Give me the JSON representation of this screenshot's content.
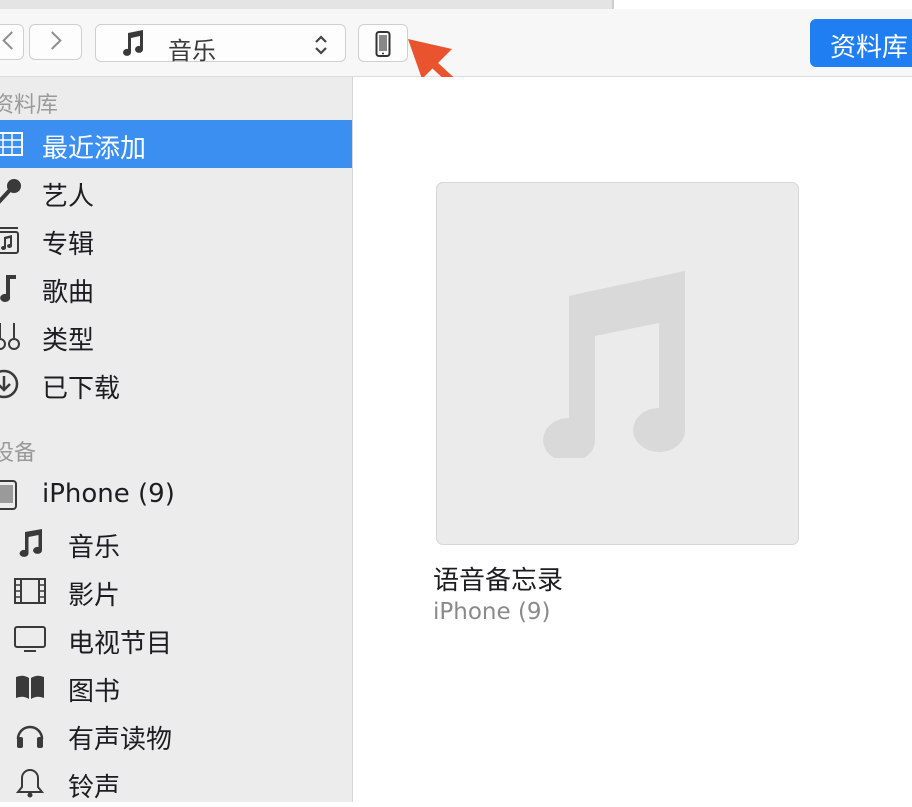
{
  "toolbar": {
    "media_kind": "音乐",
    "library_button": "资料库",
    "icons": {
      "back": "chevron-left-icon",
      "forward": "chevron-right-icon",
      "media": "music-note-icon",
      "device": "iphone-icon"
    }
  },
  "sidebar": {
    "library_header": "资料库",
    "library_items": [
      {
        "label": "最近添加",
        "icon": "recently-added-icon",
        "selected": true
      },
      {
        "label": "艺人",
        "icon": "microphone-icon",
        "selected": false
      },
      {
        "label": "专辑",
        "icon": "album-icon",
        "selected": false
      },
      {
        "label": "歌曲",
        "icon": "music-note-icon",
        "selected": false
      },
      {
        "label": "类型",
        "icon": "guitar-icon",
        "selected": false
      },
      {
        "label": "已下载",
        "icon": "download-icon",
        "selected": false
      }
    ],
    "devices_header": "设备",
    "device_name": "iPhone (9)",
    "device_items": [
      {
        "label": "音乐",
        "icon": "music-note-icon"
      },
      {
        "label": "影片",
        "icon": "film-icon"
      },
      {
        "label": "电视节目",
        "icon": "tv-icon"
      },
      {
        "label": "图书",
        "icon": "book-icon"
      },
      {
        "label": "有声读物",
        "icon": "headphones-icon"
      },
      {
        "label": "铃声",
        "icon": "bell-icon"
      }
    ]
  },
  "main": {
    "album": {
      "title": "语音备忘录",
      "subtitle": "iPhone (9)"
    }
  },
  "colors": {
    "accent": "#1e7ef2",
    "selection": "#3b8ff0",
    "annotation_arrow": "#e9542f"
  }
}
